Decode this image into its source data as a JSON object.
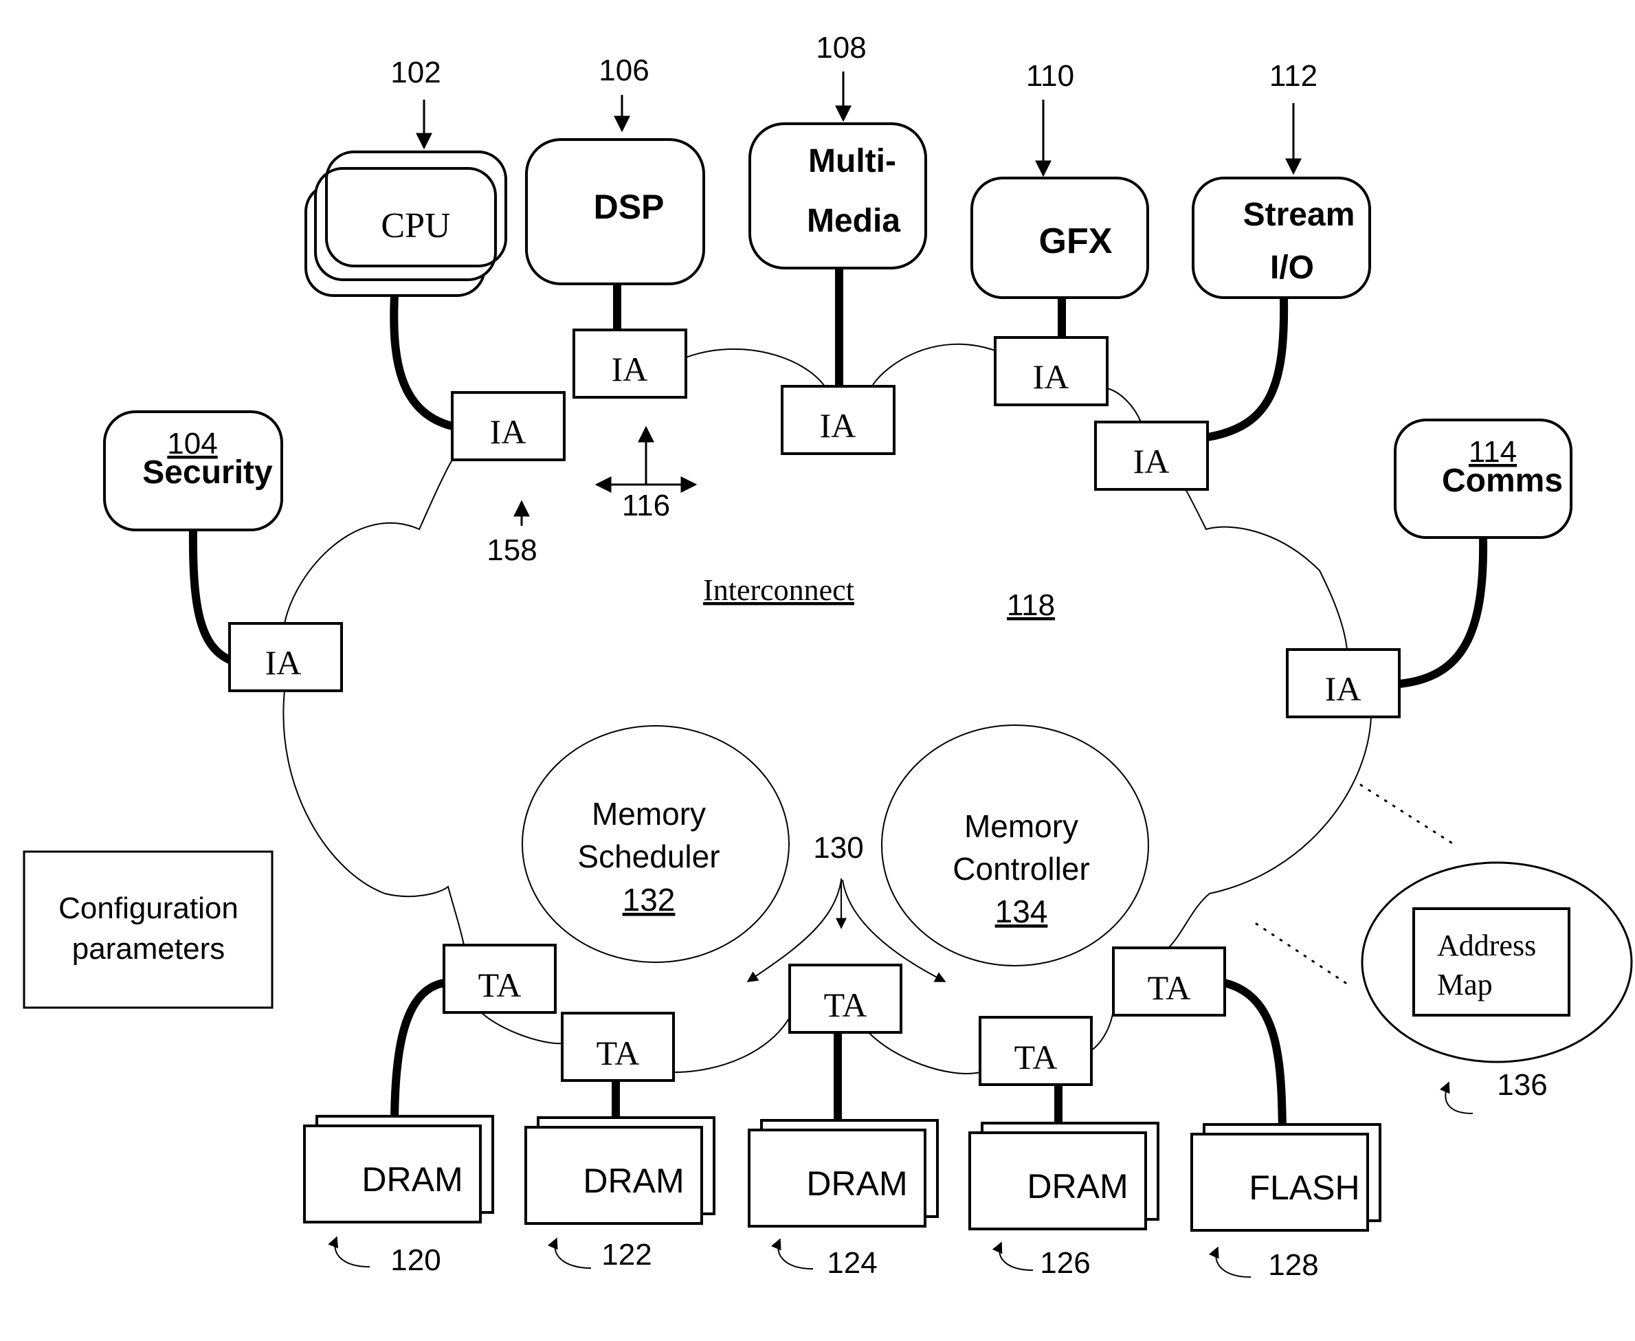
{
  "diagram": {
    "interconnect": {
      "label": "Interconnect",
      "ref": "118"
    },
    "initiators": [
      {
        "id": "cpu",
        "label": "CPU",
        "ref": "102",
        "agent": "IA"
      },
      {
        "id": "security",
        "label": "Security",
        "ref": "104",
        "agent": "IA"
      },
      {
        "id": "dsp",
        "label": "DSP",
        "ref": "106",
        "agent": "IA"
      },
      {
        "id": "multimedia",
        "label_line1": "Multi-",
        "label_line2": "Media",
        "ref": "108",
        "agent": "IA"
      },
      {
        "id": "gfx",
        "label": "GFX",
        "ref": "110",
        "agent": "IA"
      },
      {
        "id": "stream-io",
        "label_line1": "Stream",
        "label_line2": "I/O",
        "ref": "112",
        "agent": "IA"
      },
      {
        "id": "comms",
        "label": "Comms",
        "ref": "114",
        "agent": "IA"
      }
    ],
    "agent_labels": {
      "initiator": "IA",
      "target": "TA"
    },
    "annotations": {
      "ref_116": "116",
      "ref_158": "158",
      "ref_130": "130",
      "ref_136": "136"
    },
    "memory_scheduler": {
      "line1": "Memory",
      "line2": "Scheduler",
      "ref": "132"
    },
    "memory_controller": {
      "line1": "Memory",
      "line2": "Controller",
      "ref": "134"
    },
    "config": {
      "line1": "Configuration",
      "line2": "parameters"
    },
    "address_map": {
      "line1": "Address",
      "line2": "Map"
    },
    "targets": [
      {
        "label": "DRAM",
        "ref": "120",
        "agent": "TA"
      },
      {
        "label": "DRAM",
        "ref": "122",
        "agent": "TA"
      },
      {
        "label": "DRAM",
        "ref": "124",
        "agent": "TA"
      },
      {
        "label": "DRAM",
        "ref": "126",
        "agent": "TA"
      },
      {
        "label": "FLASH",
        "ref": "128",
        "agent": "TA"
      }
    ]
  }
}
